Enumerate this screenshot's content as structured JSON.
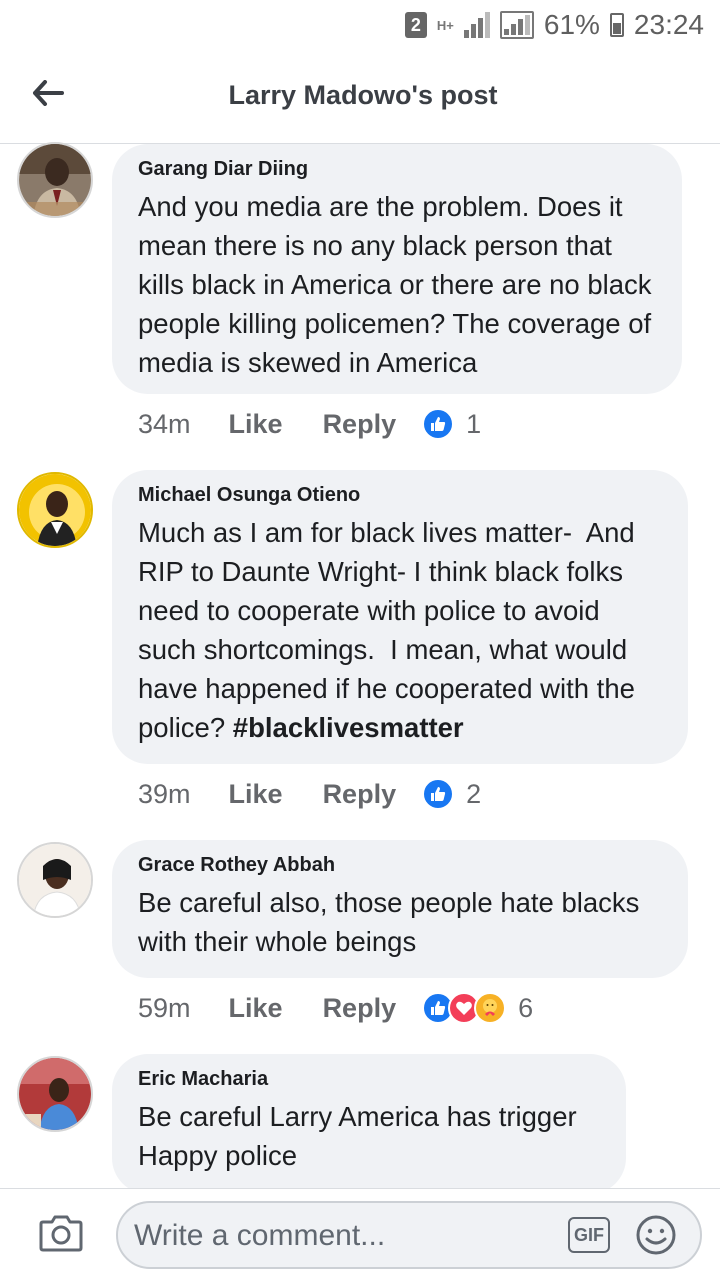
{
  "status_bar": {
    "sim_badge": "2",
    "network": "H+",
    "battery_percent": "61%",
    "time": "23:24"
  },
  "header": {
    "title": "Larry Madowo's post"
  },
  "comments": [
    {
      "author": "Garang Diar Diing",
      "text": "And you media are the problem. Does it mean there is no any black person that kills black in America or there are no black people killing policemen? The coverage of media is skewed in America",
      "time": "34m",
      "like_label": "Like",
      "reply_label": "Reply",
      "reaction_count": "1",
      "reactions": [
        "like"
      ]
    },
    {
      "author": "Michael Osunga Otieno",
      "text": "Much as I am for black lives matter-  And RIP to Daunte Wright- I think black folks need to cooperate with police to avoid such shortcomings.  I mean, what would have happened if he cooperated with the police? ",
      "hashtag": "#blacklivesmatter",
      "time": "39m",
      "like_label": "Like",
      "reply_label": "Reply",
      "reaction_count": "2",
      "reactions": [
        "like"
      ]
    },
    {
      "author": "Grace Rothey Abbah",
      "text": "Be careful also, those people hate blacks with their whole beings",
      "time": "59m",
      "like_label": "Like",
      "reply_label": "Reply",
      "reaction_count": "6",
      "reactions": [
        "like",
        "love",
        "care"
      ]
    },
    {
      "author": "Eric Macharia",
      "text": "Be careful Larry America has trigger Happy police"
    }
  ],
  "composer": {
    "placeholder": "Write a comment...",
    "gif_label": "GIF"
  },
  "colors": {
    "like_blue": "#1877f2",
    "love_red": "#f33e58",
    "care_yellow": "#f7b125",
    "bubble_bg": "#f0f2f5",
    "meta_gray": "#65676b"
  }
}
